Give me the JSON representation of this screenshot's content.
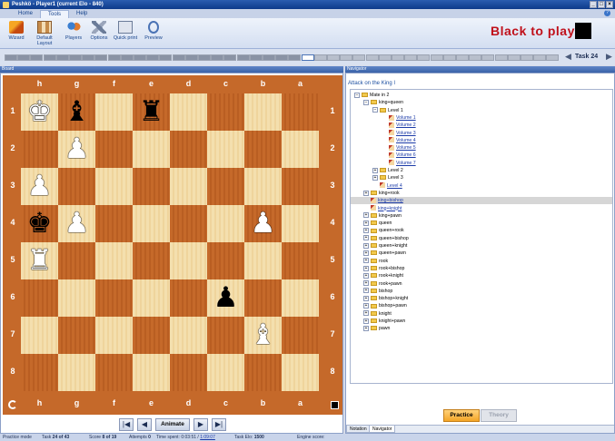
{
  "window": {
    "title": "Peshkö - Player1 (current Elo - 840)"
  },
  "ribbon": {
    "tabs": [
      "Home",
      "Tools",
      "Help"
    ],
    "active_tab": "Tools",
    "buttons": [
      {
        "label": "Wizard",
        "icon": "wizard-icon"
      },
      {
        "label": "Default Layout",
        "icon": "layout-icon"
      },
      {
        "label": "Players",
        "icon": "players-icon"
      },
      {
        "label": "Options",
        "icon": "options-icon"
      },
      {
        "label": "Quick print",
        "icon": "print-icon"
      },
      {
        "label": "Preview",
        "icon": "preview-icon"
      }
    ],
    "turn_message": "Black to play"
  },
  "progress": {
    "task_label": "Task 24"
  },
  "board": {
    "panel_title": "Board",
    "files": [
      "h",
      "g",
      "f",
      "e",
      "d",
      "c",
      "b",
      "a"
    ],
    "ranks": [
      "1",
      "2",
      "3",
      "4",
      "5",
      "6",
      "7",
      "8"
    ],
    "pieces": [
      {
        "square": "h1",
        "glyph": "♚",
        "color": "white"
      },
      {
        "square": "g1",
        "glyph": "♝",
        "color": "black"
      },
      {
        "square": "e1",
        "glyph": "♜",
        "color": "black"
      },
      {
        "square": "g2",
        "glyph": "♟",
        "color": "white"
      },
      {
        "square": "h3",
        "glyph": "♟",
        "color": "white"
      },
      {
        "square": "h4",
        "glyph": "♚",
        "color": "black"
      },
      {
        "square": "g4",
        "glyph": "♟",
        "color": "white"
      },
      {
        "square": "b4",
        "glyph": "♟",
        "color": "white"
      },
      {
        "square": "h5",
        "glyph": "♜",
        "color": "white"
      },
      {
        "square": "c6",
        "glyph": "♟",
        "color": "black"
      },
      {
        "square": "b7",
        "glyph": "♝",
        "color": "white"
      }
    ],
    "animate_label": "Animate"
  },
  "navigator": {
    "panel_title": "Navigator",
    "heading": "Attack on the King I",
    "tree": [
      {
        "label": "Mate in 2",
        "level": 0,
        "kind": "folder",
        "exp": "−"
      },
      {
        "label": "king+queen",
        "level": 1,
        "kind": "folder",
        "exp": "−"
      },
      {
        "label": "Level 1",
        "level": 2,
        "kind": "folder",
        "exp": "−"
      },
      {
        "label": "Volume 1",
        "level": 3,
        "kind": "doc"
      },
      {
        "label": "Volume 2",
        "level": 3,
        "kind": "doc"
      },
      {
        "label": "Volume 3",
        "level": 3,
        "kind": "doc"
      },
      {
        "label": "Volume 4",
        "level": 3,
        "kind": "doc"
      },
      {
        "label": "Volume 5",
        "level": 3,
        "kind": "doc"
      },
      {
        "label": "Volume 6",
        "level": 3,
        "kind": "doc"
      },
      {
        "label": "Volume 7",
        "level": 3,
        "kind": "doc"
      },
      {
        "label": "Level 2",
        "level": 2,
        "kind": "folder",
        "exp": "+"
      },
      {
        "label": "Level 3",
        "level": 2,
        "kind": "folder",
        "exp": "+"
      },
      {
        "label": "Level 4",
        "level": 2,
        "kind": "doc"
      },
      {
        "label": "king+rook",
        "level": 1,
        "kind": "folder",
        "exp": "+"
      },
      {
        "label": "king+bishop",
        "level": 1,
        "kind": "doc",
        "selected": true
      },
      {
        "label": "king+knight",
        "level": 1,
        "kind": "doc"
      },
      {
        "label": "king+pawn",
        "level": 1,
        "kind": "folder",
        "exp": "+"
      },
      {
        "label": "queen",
        "level": 1,
        "kind": "folder",
        "exp": "+"
      },
      {
        "label": "queen+rook",
        "level": 1,
        "kind": "folder",
        "exp": "+"
      },
      {
        "label": "queen+bishop",
        "level": 1,
        "kind": "folder",
        "exp": "+"
      },
      {
        "label": "queen+knight",
        "level": 1,
        "kind": "folder",
        "exp": "+"
      },
      {
        "label": "queen+pawn",
        "level": 1,
        "kind": "folder",
        "exp": "+"
      },
      {
        "label": "rook",
        "level": 1,
        "kind": "folder",
        "exp": "+"
      },
      {
        "label": "rook+bishop",
        "level": 1,
        "kind": "folder",
        "exp": "+"
      },
      {
        "label": "rook+knight",
        "level": 1,
        "kind": "folder",
        "exp": "+"
      },
      {
        "label": "rook+pawn",
        "level": 1,
        "kind": "folder",
        "exp": "+"
      },
      {
        "label": "bishop",
        "level": 1,
        "kind": "folder",
        "exp": "+"
      },
      {
        "label": "bishop+knight",
        "level": 1,
        "kind": "folder",
        "exp": "+"
      },
      {
        "label": "bishop+pawn",
        "level": 1,
        "kind": "folder",
        "exp": "+"
      },
      {
        "label": "knight",
        "level": 1,
        "kind": "folder",
        "exp": "+"
      },
      {
        "label": "knight+pawn",
        "level": 1,
        "kind": "folder",
        "exp": "+"
      },
      {
        "label": "pawn",
        "level": 1,
        "kind": "folder",
        "exp": "+"
      }
    ],
    "practice_label": "Practice",
    "theory_label": "Theory",
    "bottom_tabs": [
      "Notation",
      "Navigator"
    ],
    "active_bottom_tab": "Navigator"
  },
  "status": {
    "mode": "Practice mode",
    "task_prefix": "Task",
    "task_value": "24 of 43",
    "score_prefix": "Score",
    "score_value": "8 of 19",
    "attempts_prefix": "Attempts",
    "attempts_value": "0",
    "time_prefix": "Time spent: 0:03:51 /",
    "time_total": "1:09:07",
    "elo_prefix": "Task Elo:",
    "elo_value": "1500",
    "engine": "Engine score:"
  }
}
